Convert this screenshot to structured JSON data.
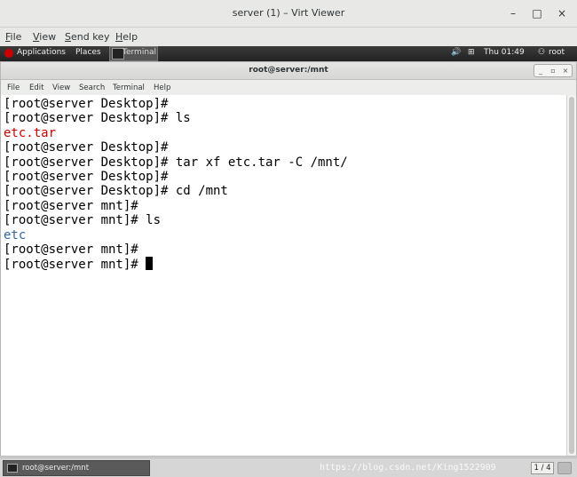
{
  "viewer": {
    "title": "server (1) – Virt Viewer",
    "menus": [
      {
        "label": "File",
        "underline": "F",
        "rest": "ile"
      },
      {
        "label": "View",
        "underline": "V",
        "rest": "iew"
      },
      {
        "label": "Send key",
        "underline": "S",
        "rest": "end key"
      },
      {
        "label": "Help",
        "underline": "H",
        "rest": "elp"
      }
    ],
    "controls": {
      "minimize": "–",
      "maximize": "□",
      "close": "×"
    }
  },
  "gnome_panel": {
    "applications": "Applications",
    "places": "Places",
    "task_label": "Terminal",
    "clock": "Thu 01:49",
    "user": "root"
  },
  "terminal": {
    "title": "root@server:/mnt",
    "menus": [
      "File",
      "Edit",
      "View",
      "Search",
      "Terminal",
      "Help"
    ],
    "lines": [
      {
        "text": "[root@server Desktop]#",
        "color": ""
      },
      {
        "text": "[root@server Desktop]# ls",
        "color": ""
      },
      {
        "text": "etc.tar",
        "color": "red"
      },
      {
        "text": "[root@server Desktop]#",
        "color": ""
      },
      {
        "text": "[root@server Desktop]# tar xf etc.tar -C /mnt/",
        "color": ""
      },
      {
        "text": "[root@server Desktop]#",
        "color": ""
      },
      {
        "text": "[root@server Desktop]# cd /mnt",
        "color": ""
      },
      {
        "text": "[root@server mnt]#",
        "color": ""
      },
      {
        "text": "[root@server mnt]# ls",
        "color": ""
      },
      {
        "text": "etc",
        "color": "blue"
      },
      {
        "text": "[root@server mnt]#",
        "color": ""
      },
      {
        "text": "[root@server mnt]# ",
        "color": "",
        "cursor": true
      }
    ]
  },
  "bottom_panel": {
    "task_label": "root@server:/mnt",
    "pager": "1 / 4",
    "watermark": "https://blog.csdn.net/King1522909"
  },
  "colors": {
    "red_text": "#cc0000",
    "blue_text": "#3465a4",
    "panel_dark": "#2b2b2b"
  }
}
